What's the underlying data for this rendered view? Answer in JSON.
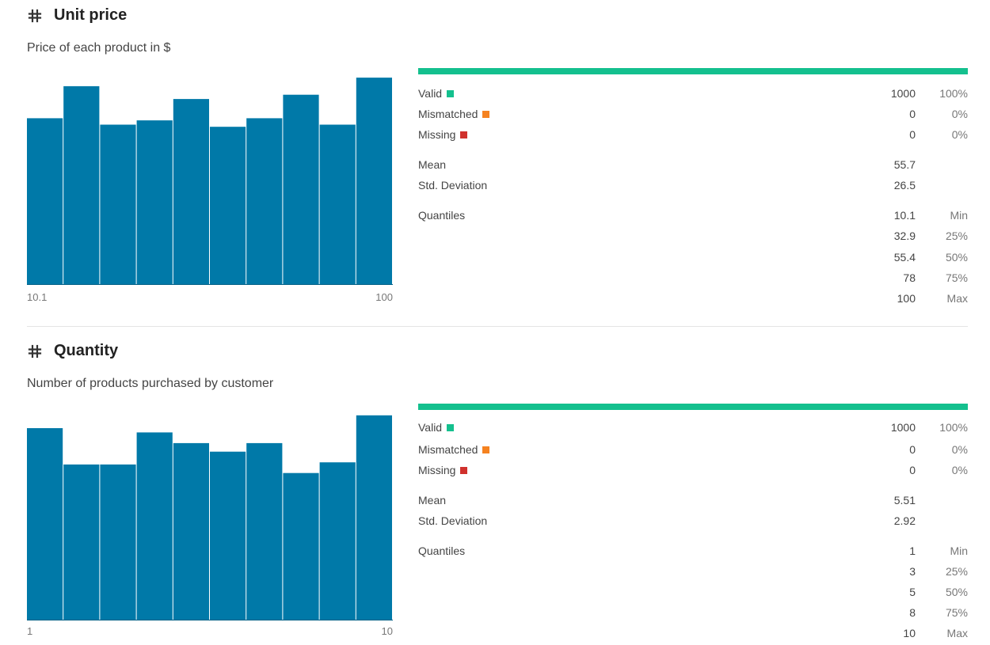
{
  "colors": {
    "bar": "#0079a8",
    "valid": "#14c08e",
    "mismatched": "#f58220",
    "missing": "#d0312d",
    "hash": "#333333"
  },
  "columns": [
    {
      "title": "Unit price",
      "icon": "hash-icon",
      "description": "Price of each product in $",
      "axis": {
        "min": "10.1",
        "max": "100"
      },
      "histogram": [
        0.78,
        0.93,
        0.75,
        0.77,
        0.87,
        0.74,
        0.78,
        0.89,
        0.75,
        0.97
      ],
      "valid": {
        "label": "Valid",
        "count": "1000",
        "pct": "100%"
      },
      "mismatched": {
        "label": "Mismatched",
        "count": "0",
        "pct": "0%"
      },
      "missing": {
        "label": "Missing",
        "count": "0",
        "pct": "0%"
      },
      "mean": {
        "label": "Mean",
        "value": "55.7"
      },
      "std": {
        "label": "Std. Deviation",
        "value": "26.5"
      },
      "quantiles_label": "Quantiles",
      "quantiles": [
        {
          "value": "10.1",
          "label": "Min"
        },
        {
          "value": "32.9",
          "label": "25%"
        },
        {
          "value": "55.4",
          "label": "50%"
        },
        {
          "value": "78",
          "label": "75%"
        },
        {
          "value": "100",
          "label": "Max"
        }
      ]
    },
    {
      "title": "Quantity",
      "icon": "hash-icon",
      "description": "Number of products purchased by customer",
      "axis": {
        "min": "1",
        "max": "10"
      },
      "histogram": [
        0.9,
        0.73,
        0.73,
        0.88,
        0.83,
        0.79,
        0.83,
        0.69,
        0.74,
        0.96
      ],
      "valid": {
        "label": "Valid",
        "count": "1000",
        "pct": "100%"
      },
      "mismatched": {
        "label": "Mismatched",
        "count": "0",
        "pct": "0%"
      },
      "missing": {
        "label": "Missing",
        "count": "0",
        "pct": "0%"
      },
      "mean": {
        "label": "Mean",
        "value": "5.51"
      },
      "std": {
        "label": "Std. Deviation",
        "value": "2.92"
      },
      "quantiles_label": "Quantiles",
      "quantiles": [
        {
          "value": "1",
          "label": "Min"
        },
        {
          "value": "3",
          "label": "25%"
        },
        {
          "value": "5",
          "label": "50%"
        },
        {
          "value": "8",
          "label": "75%"
        },
        {
          "value": "10",
          "label": "Max"
        }
      ]
    }
  ]
}
